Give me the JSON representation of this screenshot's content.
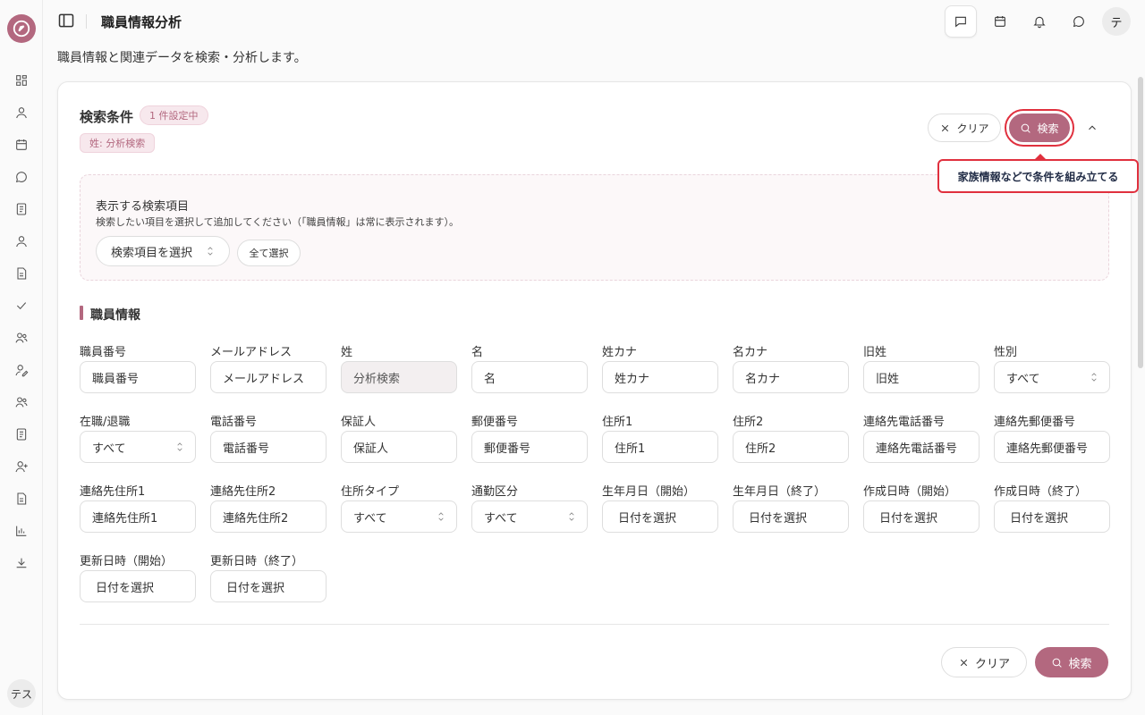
{
  "header": {
    "title": "職員情報分析",
    "user_avatar": "テ"
  },
  "sidebar": {
    "user_avatar": "テス",
    "icons": [
      "dashboard-icon",
      "user-icon",
      "calendar-icon",
      "chat-icon",
      "document-icon",
      "person-icon",
      "file-icon",
      "check-icon",
      "users-icon",
      "user-edit-icon",
      "team-icon",
      "list-icon",
      "user-add-icon",
      "report-icon",
      "chart-icon",
      "download-icon"
    ]
  },
  "page": {
    "description": "職員情報と関連データを検索・分析します。"
  },
  "search": {
    "title": "検索条件",
    "badge": "1 件設定中",
    "active_chip": "姓: 分析検索",
    "clear_label": "クリア",
    "search_label": "検索",
    "tooltip": "家族情報などで条件を組み立てる",
    "selector": {
      "title": "表示する検索項目",
      "description": "検索したい項目を選択して追加してください（「職員情報」は常に表示されます）。",
      "dropdown_label": "検索項目を選択",
      "select_all_label": "全て選択"
    },
    "section_title": "職員情報",
    "fields": [
      {
        "label": "職員番号",
        "value": "職員番号"
      },
      {
        "label": "メールアドレス",
        "value": "メールアドレス"
      },
      {
        "label": "姓",
        "value": "分析検索"
      },
      {
        "label": "名",
        "value": "名"
      },
      {
        "label": "姓カナ",
        "value": "姓カナ"
      },
      {
        "label": "名カナ",
        "value": "名カナ"
      },
      {
        "label": "旧姓",
        "value": "旧姓"
      },
      {
        "label": "性別",
        "value": "すべて"
      },
      {
        "label": "在職/退職",
        "value": "すべて"
      },
      {
        "label": "電話番号",
        "value": "電話番号"
      },
      {
        "label": "保証人",
        "value": "保証人"
      },
      {
        "label": "郵便番号",
        "value": "郵便番号"
      },
      {
        "label": "住所1",
        "value": "住所1"
      },
      {
        "label": "住所2",
        "value": "住所2"
      },
      {
        "label": "連絡先電話番号",
        "value": "連絡先電話番号"
      },
      {
        "label": "連絡先郵便番号",
        "value": "連絡先郵便番号"
      },
      {
        "label": "連絡先住所1",
        "value": "連絡先住所1"
      },
      {
        "label": "連絡先住所2",
        "value": "連絡先住所2"
      },
      {
        "label": "住所タイプ",
        "value": "すべて"
      },
      {
        "label": "通勤区分",
        "value": "すべて"
      },
      {
        "label": "生年月日（開始）",
        "value": "日付を選択"
      },
      {
        "label": "生年月日（終了）",
        "value": "日付を選択"
      },
      {
        "label": "作成日時（開始）",
        "value": "日付を選択"
      },
      {
        "label": "作成日時（終了）",
        "value": "日付を選択"
      },
      {
        "label": "更新日時（開始）",
        "value": "日付を選択"
      },
      {
        "label": "更新日時（終了）",
        "value": "日付を選択"
      }
    ],
    "footer_clear_label": "クリア",
    "footer_search_label": "検索"
  },
  "colors": {
    "accent": "#b3687f",
    "highlight": "#e0303e"
  }
}
